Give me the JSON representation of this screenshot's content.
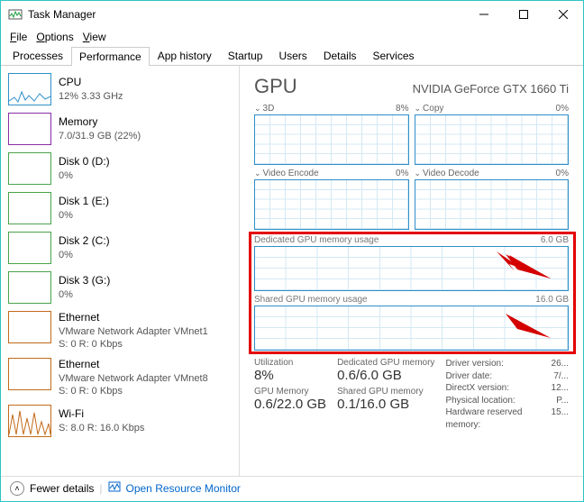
{
  "window": {
    "title": "Task Manager"
  },
  "menu": {
    "file": "File",
    "options": "Options",
    "view": "View"
  },
  "tabs": [
    "Processes",
    "Performance",
    "App history",
    "Startup",
    "Users",
    "Details",
    "Services"
  ],
  "sidebar": [
    {
      "name": "CPU",
      "detail": "12% 3.33 GHz",
      "color": "#2f8fc9"
    },
    {
      "name": "Memory",
      "detail": "7.0/31.9 GB (22%)",
      "color": "#8a2da5"
    },
    {
      "name": "Disk 0 (D:)",
      "detail": "0%",
      "color": "#4aa34a"
    },
    {
      "name": "Disk 1 (E:)",
      "detail": "0%",
      "color": "#4aa34a"
    },
    {
      "name": "Disk 2 (C:)",
      "detail": "0%",
      "color": "#4aa34a"
    },
    {
      "name": "Disk 3 (G:)",
      "detail": "0%",
      "color": "#4aa34a"
    },
    {
      "name": "Ethernet",
      "detail": "VMware Network Adapter VMnet1",
      "sub": "S: 0 R: 0 Kbps",
      "color": "#c46a1a"
    },
    {
      "name": "Ethernet",
      "detail": "VMware Network Adapter VMnet8",
      "sub": "S: 0 R: 0 Kbps",
      "color": "#c46a1a"
    },
    {
      "name": "Wi-Fi",
      "detail": "S: 8.0 R: 16.0 Kbps",
      "color": "#c46a1a"
    }
  ],
  "main": {
    "title": "GPU",
    "model": "NVIDIA GeForce GTX 1660 Ti",
    "graphs": [
      {
        "name": "3D",
        "pct": "8%"
      },
      {
        "name": "Copy",
        "pct": "0%"
      },
      {
        "name": "Video Encode",
        "pct": "0%"
      },
      {
        "name": "Video Decode",
        "pct": "0%"
      }
    ],
    "mem": [
      {
        "name": "Dedicated GPU memory usage",
        "max": "6.0 GB"
      },
      {
        "name": "Shared GPU memory usage",
        "max": "16.0 GB"
      }
    ],
    "stats": {
      "util_lbl": "Utilization",
      "util_val": "8%",
      "gmem_lbl": "GPU Memory",
      "gmem_val": "0.6/22.0 GB",
      "dmem_lbl": "Dedicated GPU memory",
      "dmem_val": "0.6/6.0 GB",
      "smem_lbl": "Shared GPU memory",
      "smem_val": "0.1/16.0 GB"
    },
    "driver": [
      {
        "k": "Driver version:",
        "v": "26..."
      },
      {
        "k": "Driver date:",
        "v": "7/..."
      },
      {
        "k": "DirectX version:",
        "v": "12..."
      },
      {
        "k": "Physical location:",
        "v": "P..."
      },
      {
        "k": "Hardware reserved memory:",
        "v": "15..."
      }
    ]
  },
  "footer": {
    "fewer": "Fewer details",
    "monitor": "Open Resource Monitor"
  }
}
